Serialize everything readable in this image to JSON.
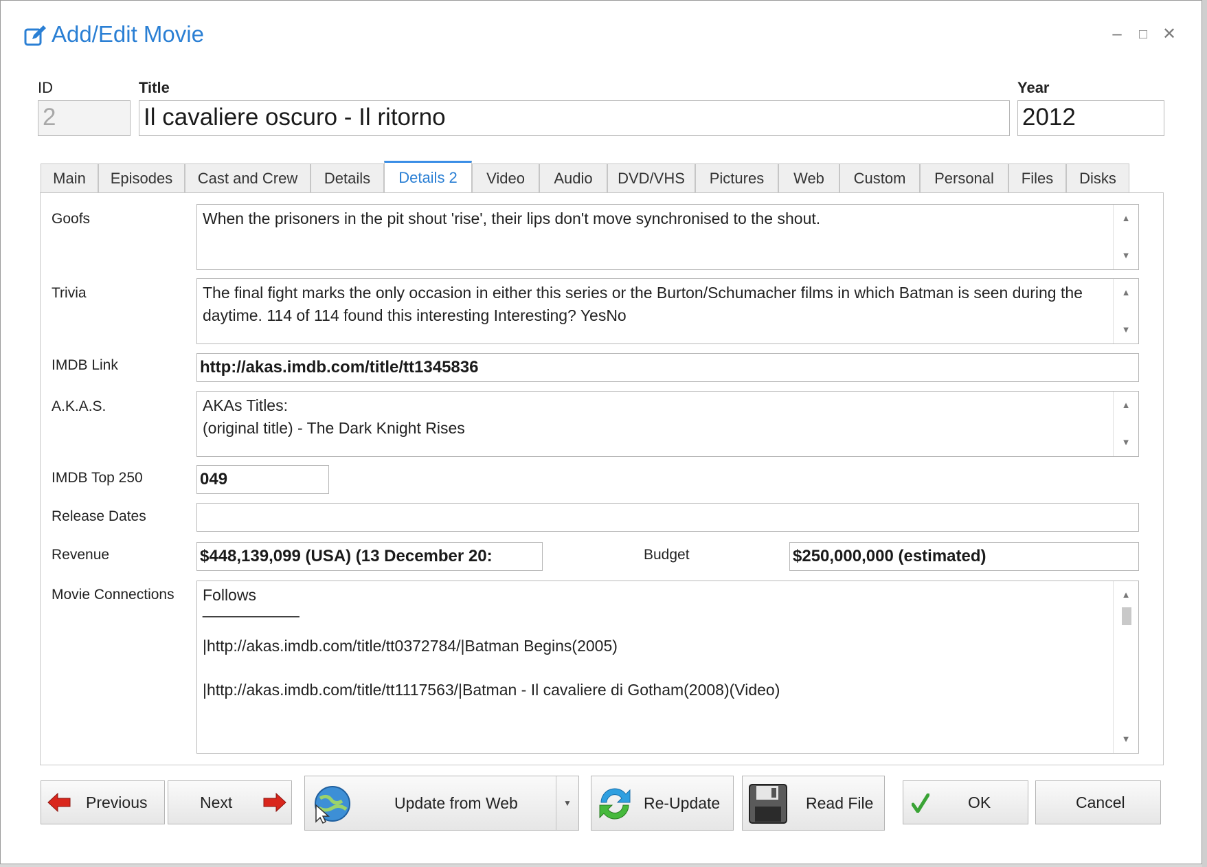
{
  "window": {
    "title": "Add/Edit Movie"
  },
  "header": {
    "id_label": "ID",
    "id_value": "2",
    "title_label": "Title",
    "title_value": "Il cavaliere oscuro - Il ritorno",
    "year_label": "Year",
    "year_value": "2012"
  },
  "tabs": [
    {
      "label": "Main"
    },
    {
      "label": "Episodes"
    },
    {
      "label": "Cast and Crew"
    },
    {
      "label": "Details"
    },
    {
      "label": "Details 2",
      "active": true
    },
    {
      "label": "Video"
    },
    {
      "label": "Audio"
    },
    {
      "label": "DVD/VHS"
    },
    {
      "label": "Pictures"
    },
    {
      "label": "Web"
    },
    {
      "label": "Custom"
    },
    {
      "label": "Personal"
    },
    {
      "label": "Files"
    },
    {
      "label": "Disks"
    }
  ],
  "fields": {
    "goofs_label": "Goofs",
    "goofs_value": "When the prisoners in the pit shout 'rise', their lips don't move synchronised to the shout.",
    "trivia_label": "Trivia",
    "trivia_value": "The final fight marks the only occasion in either this series or the Burton/Schumacher films in which Batman is seen during the daytime.   114 of 114 found this interesting  Interesting? YesNo",
    "imdb_link_label": "IMDB Link",
    "imdb_link_value": "http://akas.imdb.com/title/tt1345836",
    "akas_label": "A.K.A.S.",
    "akas_line1": "AKAs Titles:",
    "akas_line2": "(original title) - The Dark Knight Rises",
    "top250_label": "IMDB Top 250",
    "top250_value": "049",
    "release_label": "Release Dates",
    "release_value": "",
    "revenue_label": "Revenue",
    "revenue_value": "$448,139,099 (USA) (13 December 20:",
    "budget_label": "Budget",
    "budget_value": "$250,000,000 (estimated)",
    "connections_label": "Movie Connections",
    "connections_line1": "Follows",
    "connections_line2": "___________",
    "connections_line3": "|http://akas.imdb.com/title/tt0372784/|Batman Begins(2005)",
    "connections_line4": "|http://akas.imdb.com/title/tt1117563/|Batman - Il cavaliere di Gotham(2008)(Video)"
  },
  "buttons": {
    "previous": "Previous",
    "next": "Next",
    "update_web": "Update from Web",
    "reupdate": "Re-Update",
    "read_file": "Read File",
    "ok": "OK",
    "cancel": "Cancel"
  },
  "colors": {
    "accent": "#2a7fd4",
    "arrow_red": "#d9261c",
    "ok_green": "#3aa335"
  }
}
